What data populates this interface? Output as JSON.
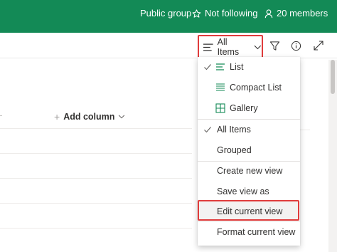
{
  "header": {
    "group_type": "Public group",
    "follow_status": "Not following",
    "members": "20 members",
    "bg_color": "#138a56"
  },
  "commandbar": {
    "view_selector_label": "All Items",
    "icons": [
      "filter-icon",
      "info-icon",
      "expand-icon"
    ]
  },
  "list": {
    "add_column_label": "Add column"
  },
  "view_menu": {
    "layouts": [
      {
        "label": "List",
        "icon": "list-icon",
        "checked": true
      },
      {
        "label": "Compact List",
        "icon": "compact-list-icon",
        "checked": false
      },
      {
        "label": "Gallery",
        "icon": "gallery-icon",
        "checked": false
      }
    ],
    "views": [
      {
        "label": "All Items",
        "checked": true
      },
      {
        "label": "Grouped",
        "checked": false
      }
    ],
    "actions": [
      {
        "label": "Create new view"
      },
      {
        "label": "Save view as"
      },
      {
        "label": "Edit current view",
        "highlighted": true
      },
      {
        "label": "Format current view"
      }
    ]
  },
  "colors": {
    "highlight_border": "#e03c3c",
    "accent": "#138a56"
  }
}
